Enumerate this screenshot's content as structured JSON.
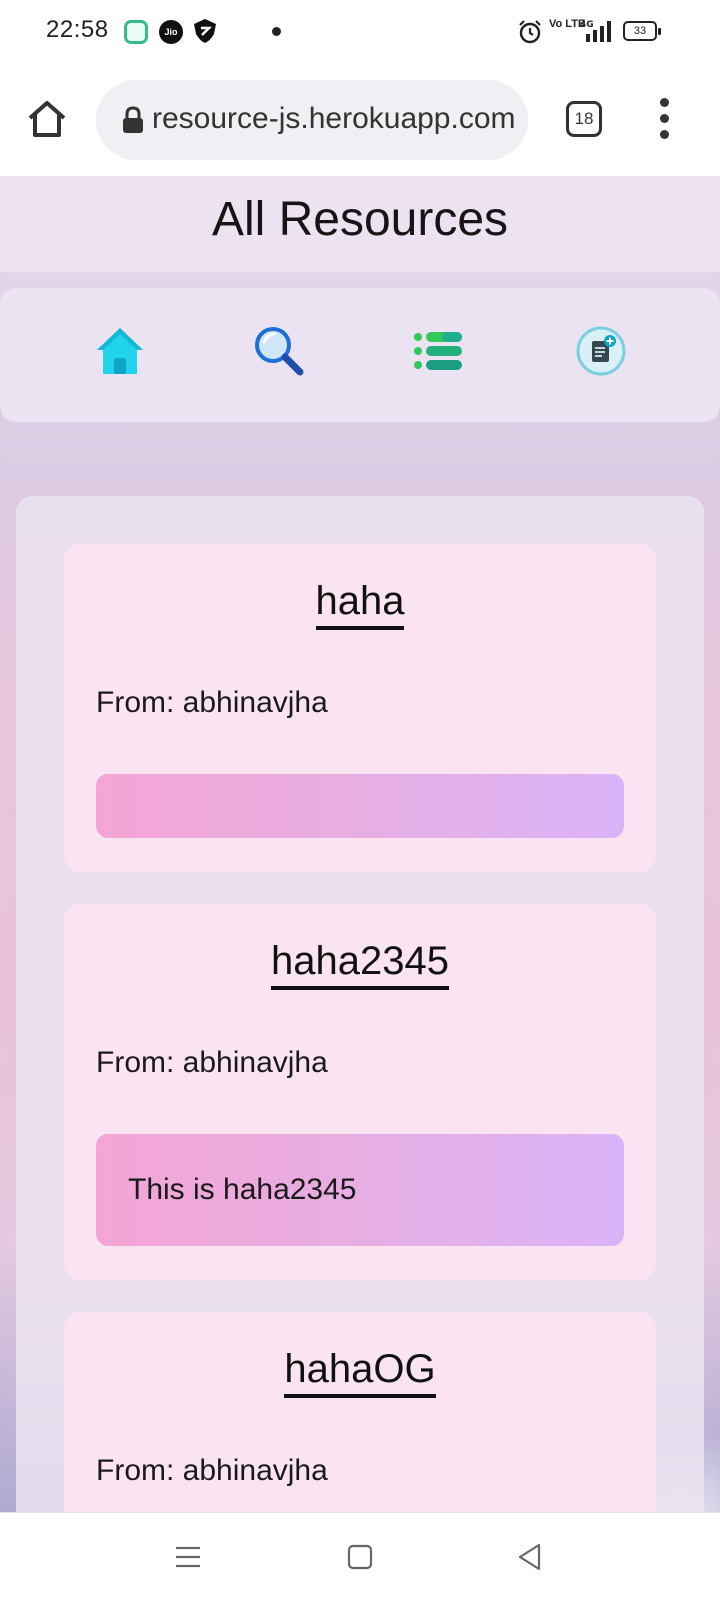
{
  "status_bar": {
    "time": "22:58",
    "notifications": [
      "app-icon",
      "jio-icon",
      "shield-icon"
    ],
    "jio_label": "Jio",
    "network": "4G",
    "volte": "Vo LTE",
    "battery": "33"
  },
  "browser": {
    "url": "resource-js.herokuapp.com",
    "tab_count": "18"
  },
  "page": {
    "title": "All Resources",
    "nav": [
      {
        "name": "home",
        "icon": "home-icon"
      },
      {
        "name": "search",
        "icon": "search-icon"
      },
      {
        "name": "list",
        "icon": "list-icon"
      },
      {
        "name": "add-resource",
        "icon": "add-note-icon"
      }
    ],
    "resources": [
      {
        "title": "haha",
        "from_label": "From:",
        "author": "abhinavjha",
        "body": ""
      },
      {
        "title": "haha2345",
        "from_label": "From:",
        "author": "abhinavjha",
        "body": "This is haha2345"
      },
      {
        "title": "hahaOG",
        "from_label": "From:",
        "author": "abhinavjha",
        "body": ""
      }
    ]
  },
  "colors": {
    "accent_home": "#22d3ee",
    "accent_search": "#1e6fd9",
    "accent_list": "#34c759",
    "card_bg": "#fbe4f1",
    "body_gradient_start": "#f4a5d5",
    "body_gradient_end": "#dab2f8"
  }
}
